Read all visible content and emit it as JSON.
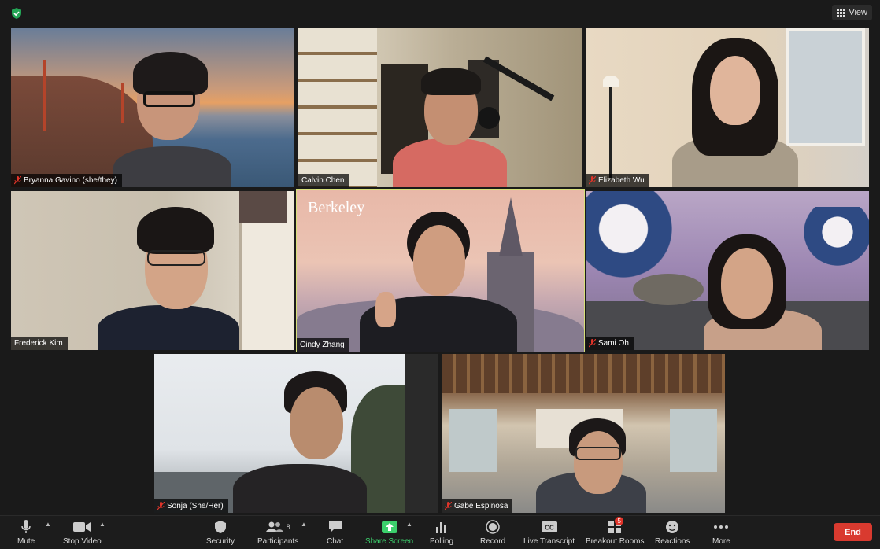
{
  "topbar": {
    "view_label": "View"
  },
  "participants": [
    {
      "name": "Bryanna Gavino (she/they)",
      "muted": true
    },
    {
      "name": "Calvin Chen",
      "muted": false
    },
    {
      "name": "Elizabeth Wu",
      "muted": true
    },
    {
      "name": "Frederick Kim",
      "muted": false
    },
    {
      "name": "Cindy Zhang",
      "muted": false
    },
    {
      "name": "Sami Oh",
      "muted": true
    },
    {
      "name": "Sonja (She/Her)",
      "muted": true
    },
    {
      "name": "Gabe Espinosa",
      "muted": true
    }
  ],
  "cindy_bg_text": "Berkeley",
  "toolbar": {
    "mute": "Mute",
    "stop_video": "Stop Video",
    "security": "Security",
    "participants": "Participants",
    "participants_count": "8",
    "chat": "Chat",
    "share_screen": "Share Screen",
    "polling": "Polling",
    "record": "Record",
    "live_transcript": "Live Transcript",
    "breakout_rooms": "Breakout Rooms",
    "breakout_badge": "5",
    "reactions": "Reactions",
    "more": "More",
    "end": "End"
  },
  "colors": {
    "accent_green": "#3ccf6c",
    "end_red": "#d93a2f",
    "active_speaker": "#d7e07a"
  }
}
